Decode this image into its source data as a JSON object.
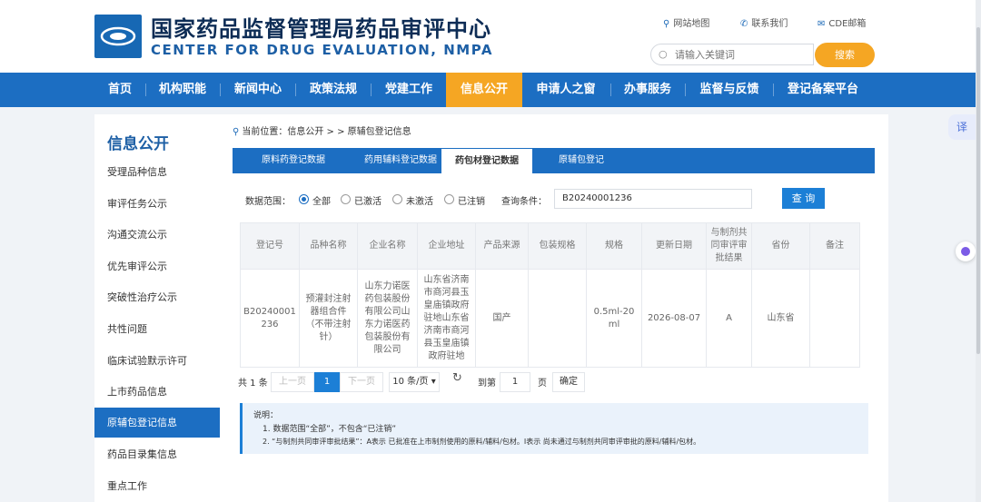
{
  "header": {
    "title_cn": "国家药品监督管理局药品审评中心",
    "title_en": "CENTER FOR DRUG EVALUATION, NMPA",
    "links": [
      "网站地图",
      "联系我们",
      "CDE邮箱"
    ],
    "search_placeholder": "请输入关键词",
    "search_button": "搜索"
  },
  "nav": {
    "items": [
      "首页",
      "机构职能",
      "新闻中心",
      "政策法规",
      "党建工作",
      "信息公开",
      "申请人之窗",
      "办事服务",
      "监督与反馈",
      "登记备案平台"
    ],
    "active": "信息公开"
  },
  "sidebar": {
    "title": "信息公开",
    "items": [
      "受理品种信息",
      "审评任务公示",
      "沟通交流公示",
      "优先审评公示",
      "突破性治疗公示",
      "共性问题",
      "临床试验默示许可",
      "上市药品信息",
      "原辅包登记信息",
      "药品目录集信息",
      "重点工作"
    ],
    "active": "原辅包登记信息"
  },
  "breadcrumb": "当前位置：信息公开 > > 原辅包登记信息",
  "tabs": {
    "items": [
      "原料药登记数据",
      "药用辅料登记数据",
      "药包材登记数据",
      "原辅包登记"
    ],
    "active": "药包材登记数据"
  },
  "filter": {
    "range_label": "数据范围：",
    "options": [
      "全部",
      "已激活",
      "未激活",
      "已注销"
    ],
    "selected": "全部",
    "query_label": "查询条件：",
    "query_value": "B20240001236",
    "query_button": "查 询"
  },
  "table": {
    "headers": [
      "登记号",
      "品种名称",
      "企业名称",
      "企业地址",
      "产品来源",
      "包装规格",
      "规格",
      "更新日期",
      "与制剂共同审评审批结果",
      "省份",
      "备注"
    ],
    "rows": [
      [
        "B20240001236",
        "预灌封注射器组合件（不带注射针）",
        "山东力诺医药包装股份有限公司山东力诺医药包装股份有限公司",
        "山东省济南市商河县玉皇庙镇政府驻地山东省济南市商河县玉皇庙镇政府驻地",
        "国产",
        "",
        "0.5ml-20ml",
        "2026-08-07",
        "A",
        "山东省",
        ""
      ]
    ]
  },
  "pagination": {
    "total": "共 1 条",
    "prev": "上一页",
    "current": "1",
    "next": "下一页",
    "page_size": "10 条/页",
    "goto_label": "到第",
    "goto_value": "1",
    "page_unit": "页",
    "confirm": "确定"
  },
  "notes": {
    "title": "说明：",
    "lines": [
      "1. 数据范围“全部”，不包含“已注销”",
      "2. “与制剂共同审评审批结果”：A表示 已批准在上市制剂使用的原料/辅料/包材。I表示 尚未通过与制剂共同审评审批的原料/辅料/包材。"
    ]
  },
  "floaters": {
    "translate": "译"
  },
  "colors": {
    "primary": "#1c6ec2",
    "accent": "#f5a623"
  },
  "icons": [
    "location-pin-icon",
    "phone-icon",
    "mail-icon",
    "search-icon",
    "refresh-icon",
    "dropdown-chevron-icon"
  ]
}
